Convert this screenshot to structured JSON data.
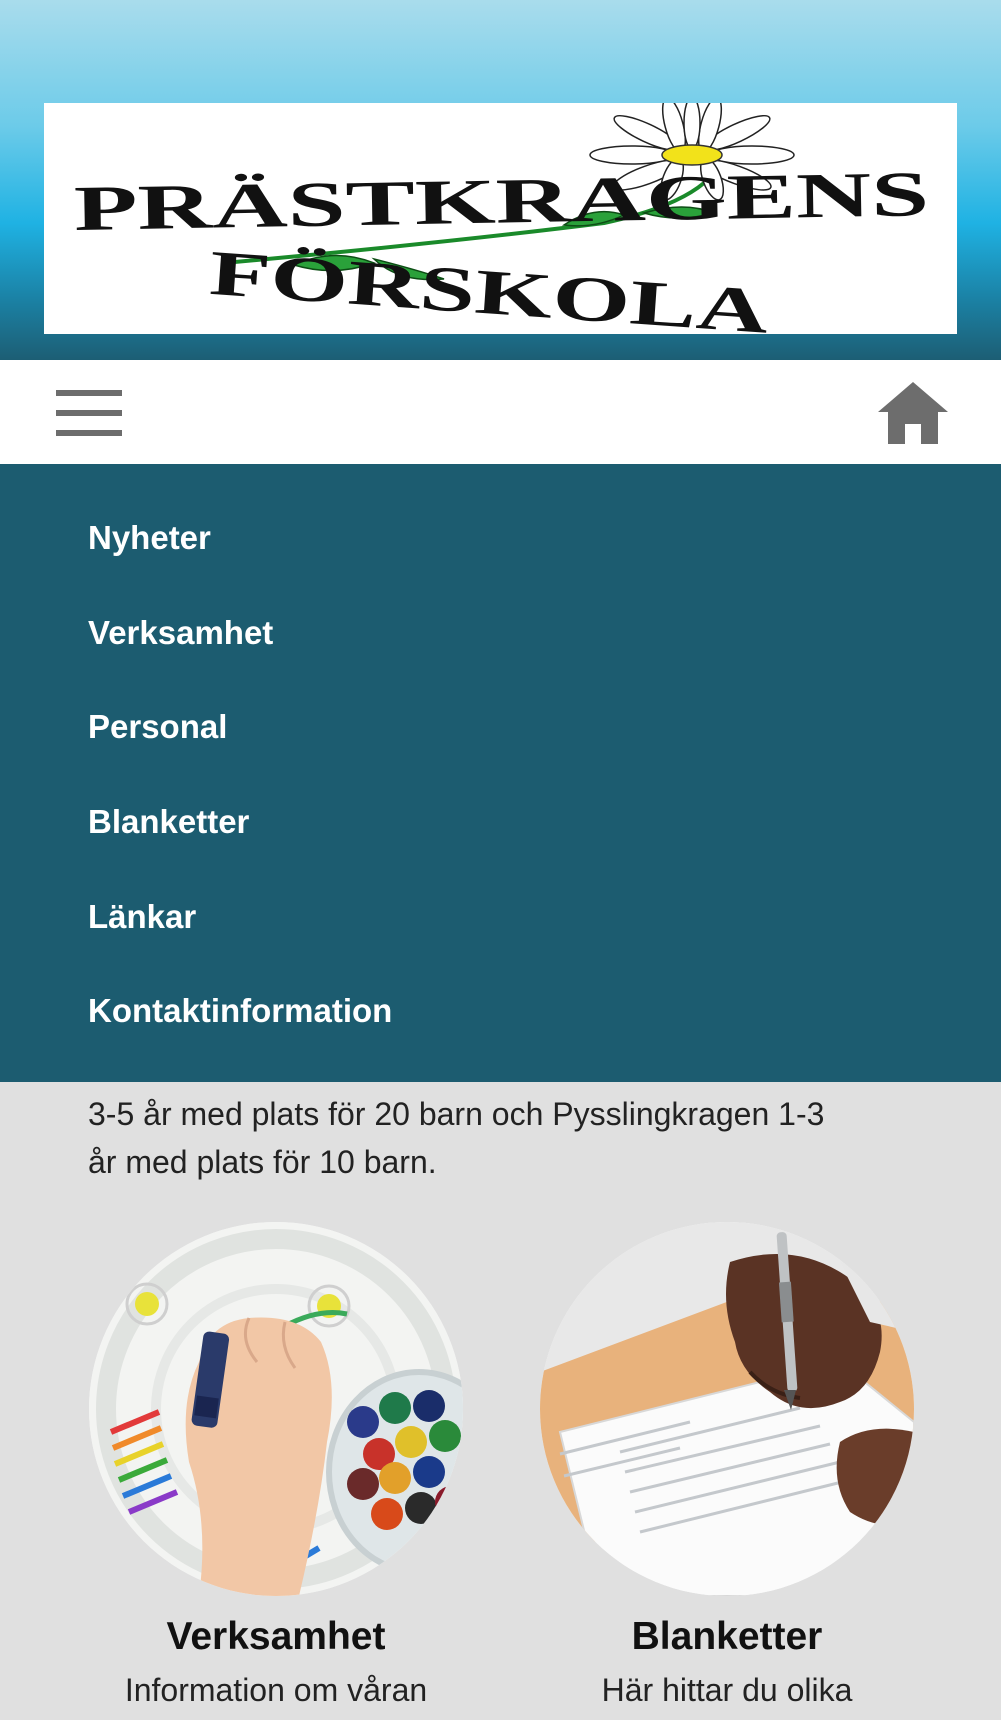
{
  "brand": {
    "logo_line1": "PRÄSTKRAGENS",
    "logo_line2": "FÖRSKOLA"
  },
  "toolbar": {
    "menu_icon": "hamburger-menu-icon",
    "home_icon": "home-icon"
  },
  "nav": {
    "items": [
      {
        "label": "Nyheter"
      },
      {
        "label": "Verksamhet"
      },
      {
        "label": "Personal"
      },
      {
        "label": "Blanketter"
      },
      {
        "label": "Länkar"
      },
      {
        "label": "Kontaktinformation"
      }
    ]
  },
  "main": {
    "intro_line1": "3-5 år med plats för 20 barn och Pysslingkragen 1-3",
    "intro_line2": "år med plats för 10 barn."
  },
  "cards": [
    {
      "title": "Verksamhet",
      "desc": "Information om våran"
    },
    {
      "title": "Blanketter",
      "desc": "Här hittar du olika"
    }
  ],
  "colors": {
    "nav_bg": "#1c5c70",
    "toolbar_bg": "#ffffff",
    "page_bg": "#e0e0e0",
    "icon_gray": "#6d6d6d"
  }
}
